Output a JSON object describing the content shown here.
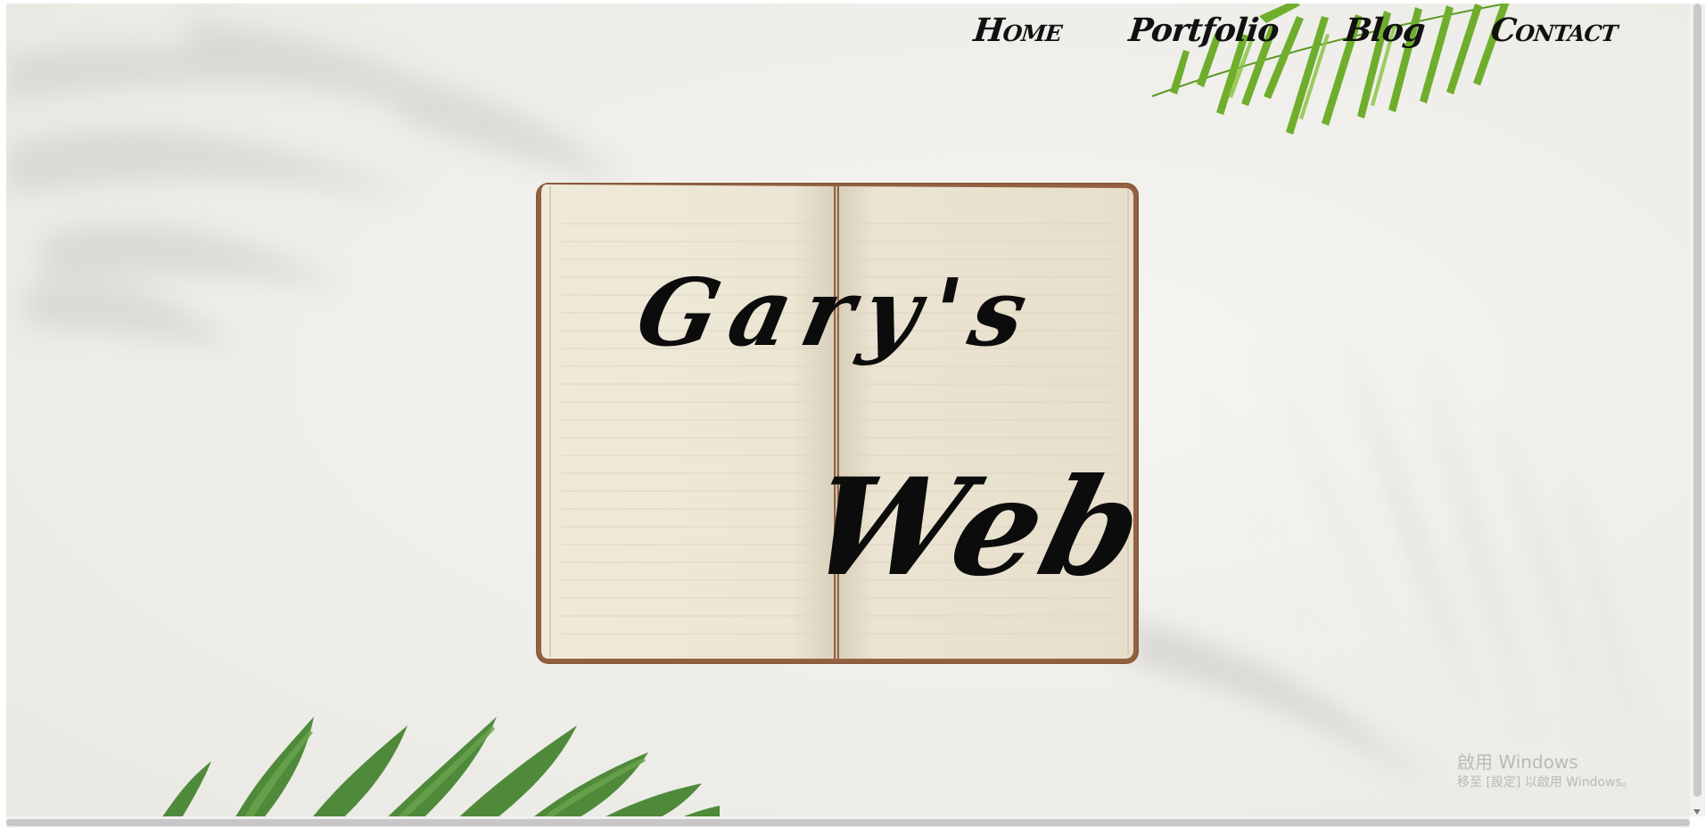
{
  "nav": {
    "home": "Home",
    "portfolio": "Portfolio",
    "blog": "Blog",
    "contact": "Contact"
  },
  "logo": {
    "line1": "Gary's",
    "line2": "Web"
  },
  "watermark": {
    "line1": "啟用 Windows",
    "line2": "移至 [設定] 以啟用 Windows。"
  },
  "colors": {
    "background": "#efeeea",
    "notebook_paper": "#ebe5d3",
    "notebook_cover": "#8b5a3c",
    "leaf_green": "#6fae2c",
    "leaf_dark_green": "#4f8a3a",
    "text": "#0c0c0c"
  },
  "icons": {
    "notebook": "open-notebook-illustration",
    "palm_top": "palm-leaf-illustration",
    "palm_bottom": "palm-leaf-illustration"
  }
}
